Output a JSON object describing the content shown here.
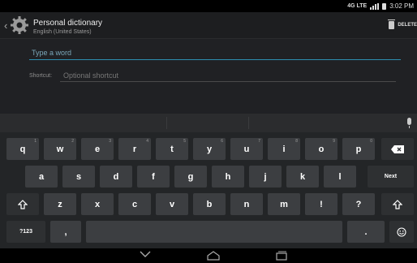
{
  "status": {
    "time": "3:02 PM",
    "network": "4G LTE"
  },
  "header": {
    "title": "Personal dictionary",
    "subtitle": "English (United States)",
    "delete_label": "DELETE"
  },
  "form": {
    "word_placeholder": "Type a word",
    "shortcut_label": "Shortcut:",
    "shortcut_placeholder": "Optional shortcut"
  },
  "keyboard": {
    "row1": [
      {
        "k": "q",
        "h": "1"
      },
      {
        "k": "w",
        "h": "2"
      },
      {
        "k": "e",
        "h": "3"
      },
      {
        "k": "r",
        "h": "4"
      },
      {
        "k": "t",
        "h": "5"
      },
      {
        "k": "y",
        "h": "6"
      },
      {
        "k": "u",
        "h": "7"
      },
      {
        "k": "i",
        "h": "8"
      },
      {
        "k": "o",
        "h": "9"
      },
      {
        "k": "p",
        "h": "0"
      }
    ],
    "row2": [
      "a",
      "s",
      "d",
      "f",
      "g",
      "h",
      "j",
      "k",
      "l"
    ],
    "next_label": "Next",
    "row3": [
      "z",
      "x",
      "c",
      "v",
      "b",
      "n",
      "m",
      "!",
      "?"
    ],
    "symbols_label": "?123",
    "comma": ",",
    "period": "."
  },
  "icons": {
    "settings": "gear-icon",
    "delete": "trash-icon",
    "mic": "microphone-icon",
    "backspace": "backspace-icon",
    "shift": "shift-icon",
    "emoji": "emoji-icon",
    "nav_back": "nav-back-icon",
    "nav_home": "nav-home-icon",
    "nav_recent": "nav-recent-icon"
  },
  "colors": {
    "accent": "#2d8fb0",
    "key": "#3c3e41",
    "keyboard_bg": "#232527"
  }
}
